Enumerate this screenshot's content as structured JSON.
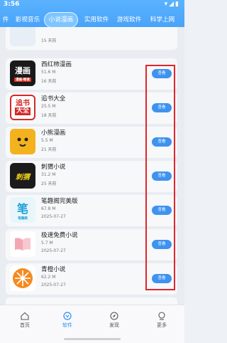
{
  "status_bar": {
    "time": "3:56",
    "icons": "▾◢▮"
  },
  "tabs": [
    {
      "label": "件"
    },
    {
      "label": "影视音乐"
    },
    {
      "label": "小说漫画"
    },
    {
      "label": "实用软件"
    },
    {
      "label": "游戏软件"
    },
    {
      "label": "科学上网"
    }
  ],
  "apps": [
    {
      "name": "",
      "size": "",
      "date": "15 天前",
      "icon": "partial"
    },
    {
      "name": "西红柿漫画",
      "size": "51.6 M",
      "date": "16 天前",
      "button": "查看",
      "icon_text": "漫画",
      "icon_sub": "漫画·畅读"
    },
    {
      "name": "追书大全",
      "size": "25.5 M",
      "date": "18 天前",
      "button": "查看",
      "icon_text": "追书",
      "icon_sub": "大全"
    },
    {
      "name": "小熊漫画",
      "size": "5.5 M",
      "date": "21 天前",
      "button": "查看",
      "icon_text": ""
    },
    {
      "name": "刺猬小说",
      "size": "31.2 M",
      "date": "25 天前",
      "button": "查看",
      "icon_text": "刺猬"
    },
    {
      "name": "笔趣阁完美版",
      "size": "67.8 M",
      "date": "2025-07-27",
      "button": "查看",
      "icon_text": "笔",
      "icon_sub": "笔趣阁"
    },
    {
      "name": "极速免费小说",
      "size": "5.7 M",
      "date": "2025-07-27",
      "button": "查看",
      "icon_text": ""
    },
    {
      "name": "青橙小说",
      "size": "62.2 M",
      "date": "2025-07-27",
      "button": "查看",
      "icon_text": ""
    }
  ],
  "bottom_nav": [
    {
      "label": "首页",
      "icon": "home-icon"
    },
    {
      "label": "软件",
      "icon": "software-icon",
      "active": true
    },
    {
      "label": "发现",
      "icon": "compass-icon"
    },
    {
      "label": "更多",
      "icon": "more-icon"
    }
  ],
  "colors": {
    "accent": "#3e92f0",
    "highlight_box": "#e0262c"
  }
}
